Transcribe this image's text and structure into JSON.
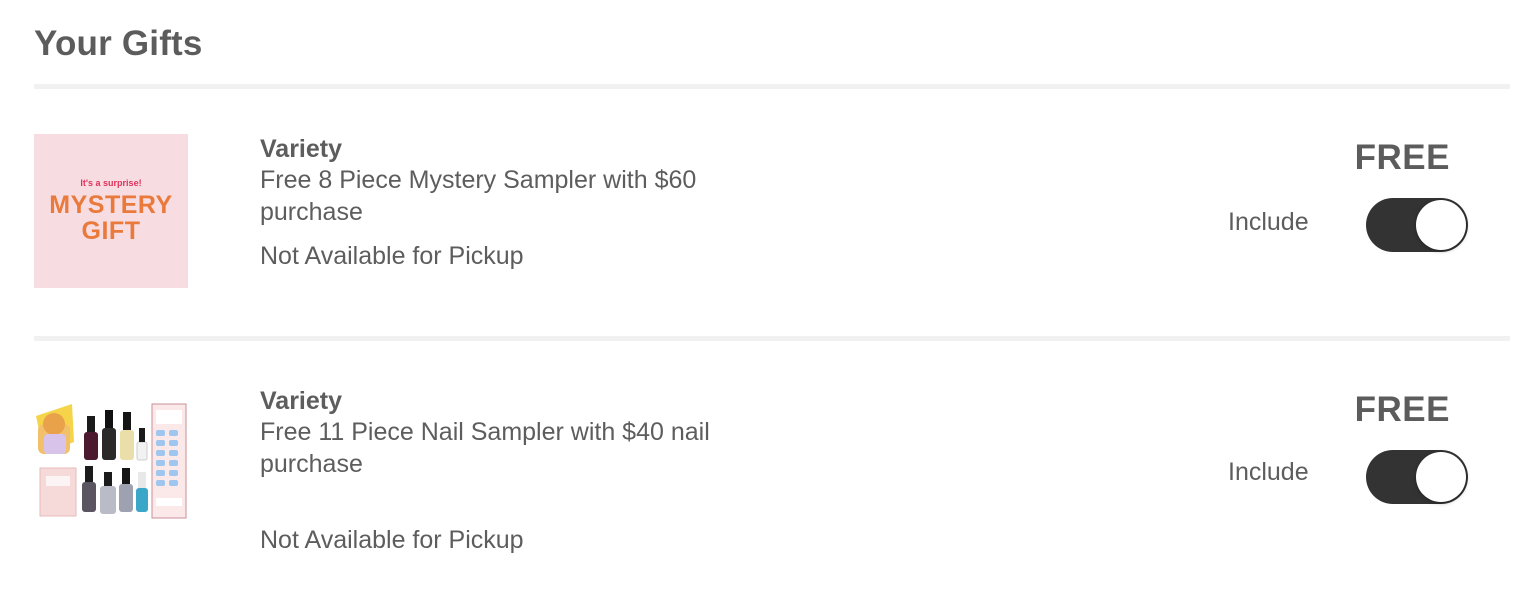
{
  "section": {
    "title": "Your Gifts"
  },
  "gifts": [
    {
      "thumb_tagline": "It's a surprise!",
      "thumb_line1": "MYSTERY",
      "thumb_line2": "GIFT",
      "brand": "Variety",
      "description": "Free 8 Piece Mystery Sampler with $60 purchase",
      "pickup": "Not Available for Pickup",
      "price": "FREE",
      "include_label": "Include",
      "included": true
    },
    {
      "brand": "Variety",
      "description": "Free 11 Piece Nail Sampler with $40 nail purchase",
      "pickup": "Not Available for Pickup",
      "price": "FREE",
      "include_label": "Include",
      "included": true
    }
  ],
  "colors": {
    "toggle_on": "#333333",
    "mystery_bg": "#f7dde2",
    "mystery_text": "#ea7a3c",
    "mystery_tag": "#e0315a"
  }
}
